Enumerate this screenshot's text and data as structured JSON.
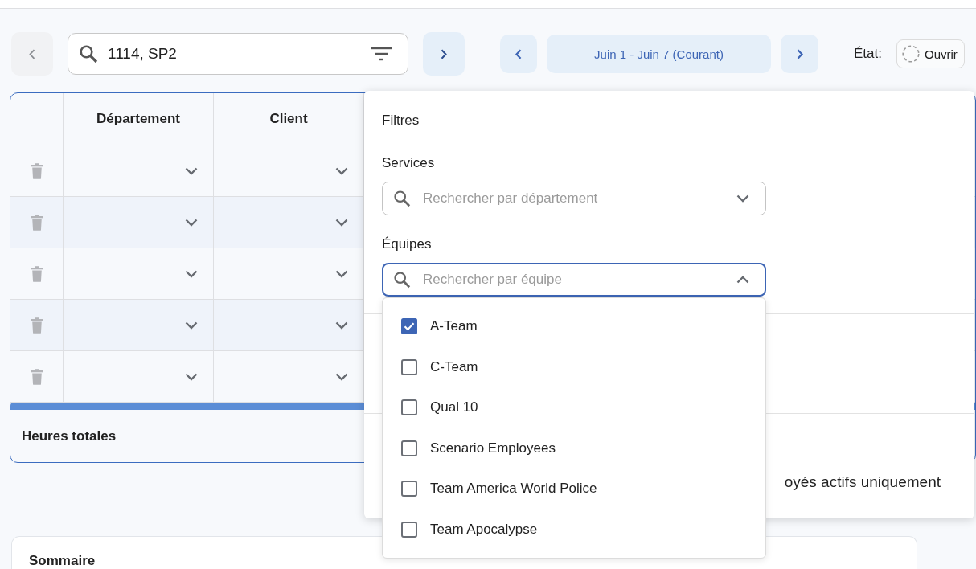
{
  "toolbar": {
    "search": {
      "value": "1114, SP2"
    },
    "week": {
      "label": "Juin 1 - Juin 7 (Courant)"
    },
    "status": {
      "label": "État:",
      "value": "Ouvrir"
    }
  },
  "table": {
    "columns": [
      "Département",
      "Client"
    ],
    "rows": [
      {
        "deletable": true
      },
      {
        "deletable": true
      },
      {
        "deletable": true
      },
      {
        "deletable": true
      },
      {
        "deletable": true
      }
    ],
    "footer": {
      "label": "Heures totales"
    }
  },
  "filters": {
    "title": "Filtres",
    "groups": [
      {
        "label": "Services",
        "placeholder": "Rechercher par département",
        "expanded": false
      },
      {
        "label": "Équipes",
        "placeholder": "Rechercher par équipe",
        "expanded": true,
        "options": [
          {
            "label": "A-Team",
            "checked": true
          },
          {
            "label": "C-Team",
            "checked": false
          },
          {
            "label": "Qual 10",
            "checked": false
          },
          {
            "label": "Scenario Employees",
            "checked": false
          },
          {
            "label": "Team America World Police",
            "checked": false
          },
          {
            "label": "Team Apocalypse",
            "checked": false
          }
        ]
      }
    ],
    "option_text": "oyés actifs uniquement"
  },
  "summary": {
    "title": "Sommaire"
  }
}
